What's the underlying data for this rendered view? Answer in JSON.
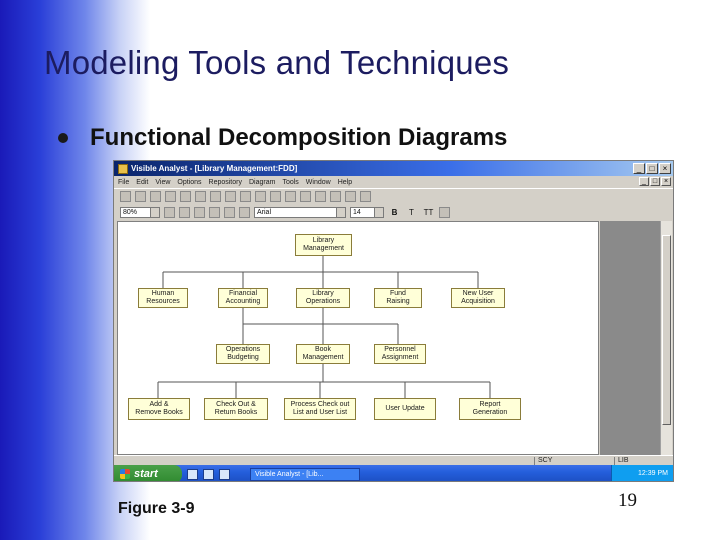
{
  "slide": {
    "title": "Modeling Tools and Techniques",
    "bullet": "Functional Decomposition Diagrams",
    "figure_caption": "Figure 3-9",
    "page_number": "19"
  },
  "app": {
    "window_title": "Visible Analyst - [Library Management:FDD]",
    "window_buttons": [
      "_",
      "□",
      "×"
    ],
    "menu": [
      "File",
      "Edit",
      "View",
      "Options",
      "Repository",
      "Diagram",
      "Tools",
      "Window",
      "Help"
    ],
    "toolbar2": {
      "zoom_value": "80%",
      "font_value": "Arial",
      "size_value": "14",
      "bold": "B",
      "italic": "T",
      "underline": "TT"
    },
    "status": {
      "cell_left": "SCY",
      "cell_right": "LIB"
    },
    "taskbar": {
      "start": "start",
      "task_item": "Visible Analyst - [Lib...",
      "clock": "12:39 PM"
    }
  },
  "fdd": {
    "root": "Library\nManagement",
    "level1": [
      "Human\nResources",
      "Financial\nAccounting",
      "Library\nOperations",
      "Fund\nRaising",
      "New User\nAcquisition"
    ],
    "level2": [
      "Operations\nBudgeting",
      "Book\nManagement",
      "Personnel\nAssignment"
    ],
    "level3": [
      "Add &\nRemove Books",
      "Check Out &\nReturn Books",
      "Process Check out\nList and User List",
      "User Update",
      "Report\nGeneration"
    ]
  }
}
